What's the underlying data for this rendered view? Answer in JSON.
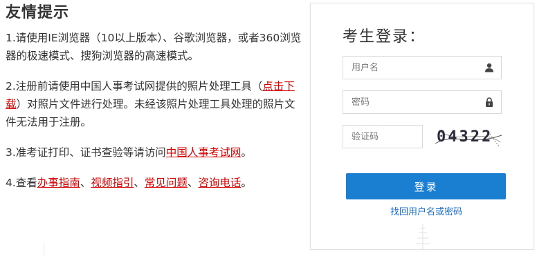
{
  "notice": {
    "title": "友情提示",
    "item1": "1.请使用IE浏览器（10以上版本）、谷歌浏览器，或者360浏览器的极速模式、搜狗浏览器的高速模式。",
    "item2_before": "2.注册前请使用中国人事考试网提供的照片处理工具（",
    "item2_link": "点击下载",
    "item2_after": "）对照片文件进行处理。未经该照片处理工具处理的照片文件无法用于注册。",
    "item3_before": "3.准考证打印、证书查验等请访问",
    "item3_link": "中国人事考试网",
    "item3_after": "。",
    "item4_before": "4.查看",
    "item4_links": [
      "办事指南",
      "视频指引",
      "常见问题",
      "咨询电话"
    ],
    "item4_sep": "、",
    "item4_after": "。"
  },
  "login": {
    "title": "考生登录：",
    "username_placeholder": "用户名",
    "password_placeholder": "密码",
    "captcha_placeholder": "验证码",
    "captcha_code": "04322",
    "submit_label": "登录",
    "forgot_label": "找回用户名或密码"
  },
  "icons": {
    "user": "user-icon",
    "lock": "lock-icon"
  },
  "colors": {
    "link_red": "#d40000",
    "button_blue": "#1b7fd1",
    "forgot_blue": "#1b6fc8"
  }
}
